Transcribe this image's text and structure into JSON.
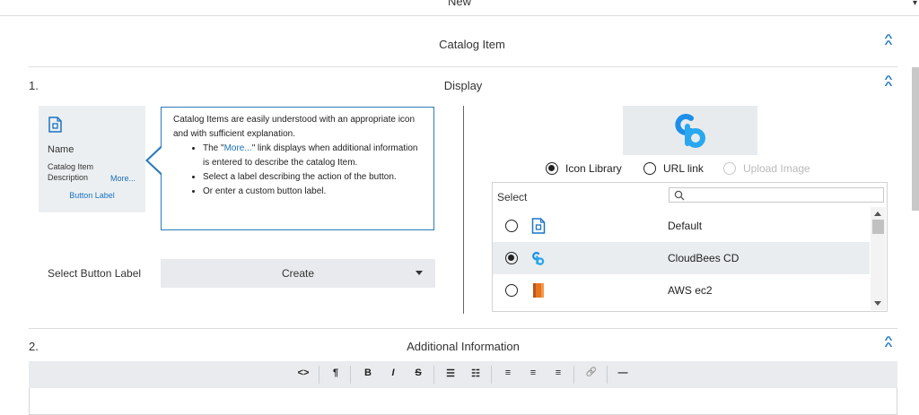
{
  "header": {
    "title": "New",
    "corner_glyph": "▾"
  },
  "catalog_section": {
    "title": "Catalog Item"
  },
  "display_section": {
    "number": "1.",
    "title": "Display"
  },
  "preview": {
    "name": "Name",
    "description_line1": "Catalog Item",
    "description_line2": "Description",
    "more": "More...",
    "button_label": "Button Label"
  },
  "tooltip": {
    "intro": "Catalog Items are easily understood with an appropriate icon and with sufficient explanation.",
    "bullet1_pre": "The \"",
    "bullet1_link": "More...",
    "bullet1_post": "\" link displays when additional information is entered to describe the catalog Item.",
    "bullet2": "Select a label describing the action of the button.",
    "bullet3": "Or enter a custom button label."
  },
  "button_label_select": {
    "label": "Select Button Label",
    "value": "Create"
  },
  "icon_source": {
    "options": [
      {
        "label": "Icon Library",
        "selected": true,
        "disabled": false
      },
      {
        "label": "URL link",
        "selected": false,
        "disabled": false
      },
      {
        "label": "Upload Image",
        "selected": false,
        "disabled": true
      }
    ]
  },
  "icon_list": {
    "select_label": "Select",
    "search_placeholder": "",
    "rows": [
      {
        "label": "Default",
        "icon": "document-icon",
        "selected": false
      },
      {
        "label": "CloudBees CD",
        "icon": "cloudbees-icon",
        "selected": true
      },
      {
        "label": "AWS ec2",
        "icon": "aws-ec2-icon",
        "selected": false
      }
    ]
  },
  "additional_section": {
    "number": "2.",
    "title": "Additional Information"
  },
  "toolbar": {
    "code": "<>",
    "paragraph": "¶",
    "bold": "B",
    "italic": "I",
    "strike": "S",
    "ul": "☰",
    "ol": "☷",
    "align_left": "≡",
    "align_center": "≡",
    "align_right": "≡",
    "link": "🔗",
    "hr": "—"
  },
  "colors": {
    "accent": "#1a73c7",
    "tooltip_border": "#2a7ab8",
    "aws": "#e8741e",
    "cloudbees": "#2196f3"
  }
}
